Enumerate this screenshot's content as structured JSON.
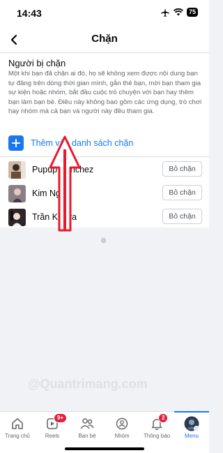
{
  "status": {
    "time": "14:43",
    "battery": "75"
  },
  "header": {
    "title": "Chặn"
  },
  "section": {
    "title": "Người bị chặn",
    "description": "Một khi bạn đã chặn ai đó, họ sẽ không xem được nội dung bạn tự đăng trên dòng thời gian mình, gắn thẻ bạn, mời bạn tham gia sự kiện hoặc nhóm, bắt đầu cuộc trò chuyện với bạn hay thêm bạn làm bạn bè. Điều này không bao gồm các ứng dụng, trò chơi hay nhóm mà cả bạn và người này đều tham gia."
  },
  "add": {
    "label": "Thêm vào danh sách chặn"
  },
  "blocked": [
    {
      "name": "Pupup Sanchez",
      "button": "Bỏ chặn"
    },
    {
      "name": "Kim Ngân",
      "button": "Bỏ chặn"
    },
    {
      "name": "Trần Kimira",
      "button": "Bỏ chặn"
    }
  ],
  "watermark": "@Quantrimang.com",
  "nav": [
    {
      "label": "Trang chủ",
      "icon": "home-icon"
    },
    {
      "label": "Reels",
      "icon": "reels-icon",
      "badge": "9+"
    },
    {
      "label": "Bạn bè",
      "icon": "friends-icon"
    },
    {
      "label": "Nhóm",
      "icon": "groups-icon"
    },
    {
      "label": "Thông báo",
      "icon": "bell-icon",
      "badge": "2"
    },
    {
      "label": "Menu",
      "icon": "menu-avatar-icon"
    }
  ],
  "colors": {
    "accent": "#1877f2",
    "badge": "#e41e3f",
    "annotation_arrow": "#e8192c"
  }
}
